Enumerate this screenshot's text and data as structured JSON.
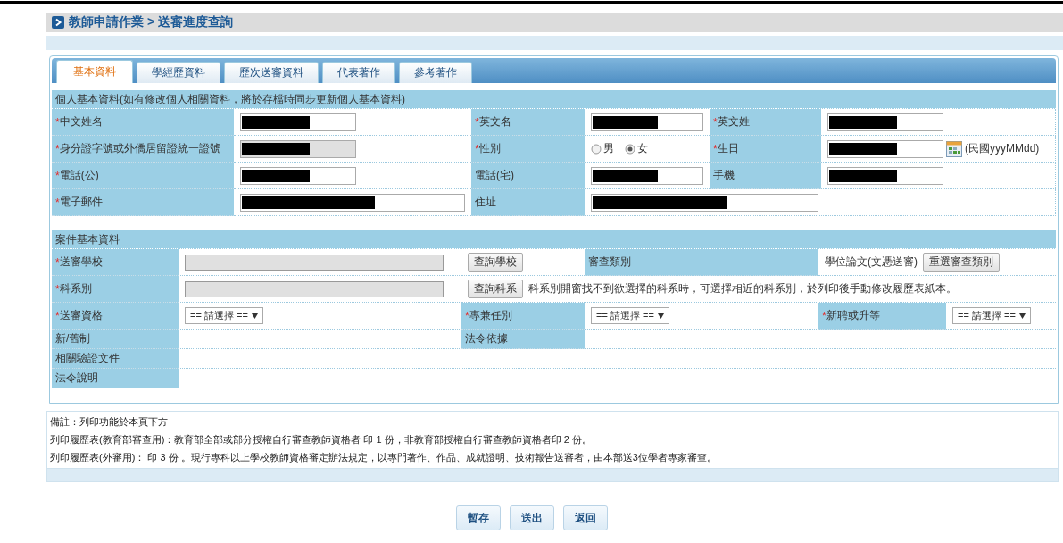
{
  "breadcrumb": "教師申請作業 > 送審進度查詢",
  "tabs": [
    {
      "label": "基本資料",
      "selected": true
    },
    {
      "label": "學經歷資料",
      "selected": false
    },
    {
      "label": "歷次送審資料",
      "selected": false
    },
    {
      "label": "代表著作",
      "selected": false
    },
    {
      "label": "參考著作",
      "selected": false
    }
  ],
  "personal": {
    "heading": "個人基本資料(如有修改個人相關資料，將於存檔時同步更新個人基本資料)",
    "rows": [
      [
        {
          "label": "中文姓名",
          "required_mark": "*",
          "kind": "text",
          "redacted": true
        },
        {
          "label": "英文名",
          "required_mark": "*",
          "kind": "text",
          "redacted": true
        },
        {
          "label": "英文姓",
          "required_mark": "*",
          "kind": "text",
          "redacted": true
        }
      ],
      [
        {
          "label": "身分證字號或外僑居留證統一證號",
          "required_mark": "*",
          "kind": "text",
          "redacted": true,
          "disabled": true
        },
        {
          "label": "性別",
          "required_mark": "*",
          "kind": "radio",
          "options": [
            {
              "label": "男",
              "selected": false
            },
            {
              "label": "女",
              "selected": true
            }
          ]
        },
        {
          "label": "生日",
          "required_mark": "*",
          "kind": "date",
          "redacted": true,
          "hint": "(民國yyyMMdd)"
        }
      ],
      [
        {
          "label": "電話(公)",
          "required_mark": "*",
          "kind": "text",
          "redacted": true
        },
        {
          "label": "電話(宅)",
          "kind": "text",
          "redacted": true
        },
        {
          "label": "手機",
          "kind": "text",
          "redacted": true
        }
      ],
      [
        {
          "label": "電子郵件",
          "required_mark": "*",
          "kind": "wide",
          "redacted": true
        },
        {
          "label": "住址",
          "kind": "wide",
          "redacted": true
        }
      ]
    ]
  },
  "case": {
    "heading": "案件基本資料",
    "rows": [
      [
        {
          "kind": "label",
          "text": "送審學校",
          "required_mark": "*"
        },
        {
          "kind": "value",
          "items": [
            {
              "kind": "input",
              "disabled": true
            }
          ]
        },
        {
          "kind": "value",
          "items": [
            {
              "kind": "button",
              "label": "查詢學校"
            }
          ]
        },
        {
          "kind": "label",
          "text": "審查類別"
        },
        {
          "kind": "value",
          "items": [
            {
              "kind": "text",
              "text": "學位論文(文憑送審)"
            },
            {
              "kind": "button",
              "label": "重選審查類別"
            }
          ]
        }
      ],
      [
        {
          "kind": "label",
          "text": "科系別",
          "required_mark": "*"
        },
        {
          "kind": "value",
          "items": [
            {
              "kind": "input",
              "disabled": true
            }
          ]
        },
        {
          "kind": "value",
          "items": [
            {
              "kind": "button",
              "label": "查詢科系"
            },
            {
              "kind": "text",
              "text": "科系別開窗找不到欲選擇的科系時，可選擇相近的科系別，於列印後手動修改履歷表紙本。"
            }
          ]
        }
      ],
      [
        {
          "kind": "label",
          "text": "送審資格",
          "required_mark": "*"
        },
        {
          "kind": "value",
          "items": [
            {
              "kind": "select",
              "value": "== 請選擇 =="
            }
          ]
        },
        {
          "kind": "label",
          "text": "專兼任別",
          "required_mark": "*"
        },
        {
          "kind": "value",
          "items": [
            {
              "kind": "select",
              "value": "== 請選擇 =="
            }
          ]
        },
        {
          "kind": "label",
          "text": "新聘或升等",
          "required_mark": "*"
        },
        {
          "kind": "value",
          "items": [
            {
              "kind": "select",
              "value": "== 請選擇 =="
            }
          ]
        }
      ],
      [
        {
          "kind": "label",
          "text": "新/舊制"
        },
        {
          "kind": "value"
        },
        {
          "kind": "label",
          "text": "法令依據"
        },
        {
          "kind": "value"
        }
      ],
      [
        {
          "kind": "label",
          "text": "相關驗證文件"
        },
        {
          "kind": "value"
        }
      ],
      [
        {
          "kind": "label",
          "text": "法令說明"
        },
        {
          "kind": "value"
        }
      ]
    ]
  },
  "notes": [
    "備註：列印功能於本頁下方",
    "列印履歷表(教育部審查用)：教育部全部或部分授權自行審查教師資格者 印 1 份，非教育部授權自行審查教師資格者印 2 份。",
    "列印履歷表(外審用)： 印 3 份 。現行專科以上學校教師資格審定辦法規定，以專門著作、作品、成就證明、技術報告送審者，由本部送3位學者專家審查。"
  ],
  "buttons": [
    "暫存",
    "送出",
    "返回"
  ]
}
